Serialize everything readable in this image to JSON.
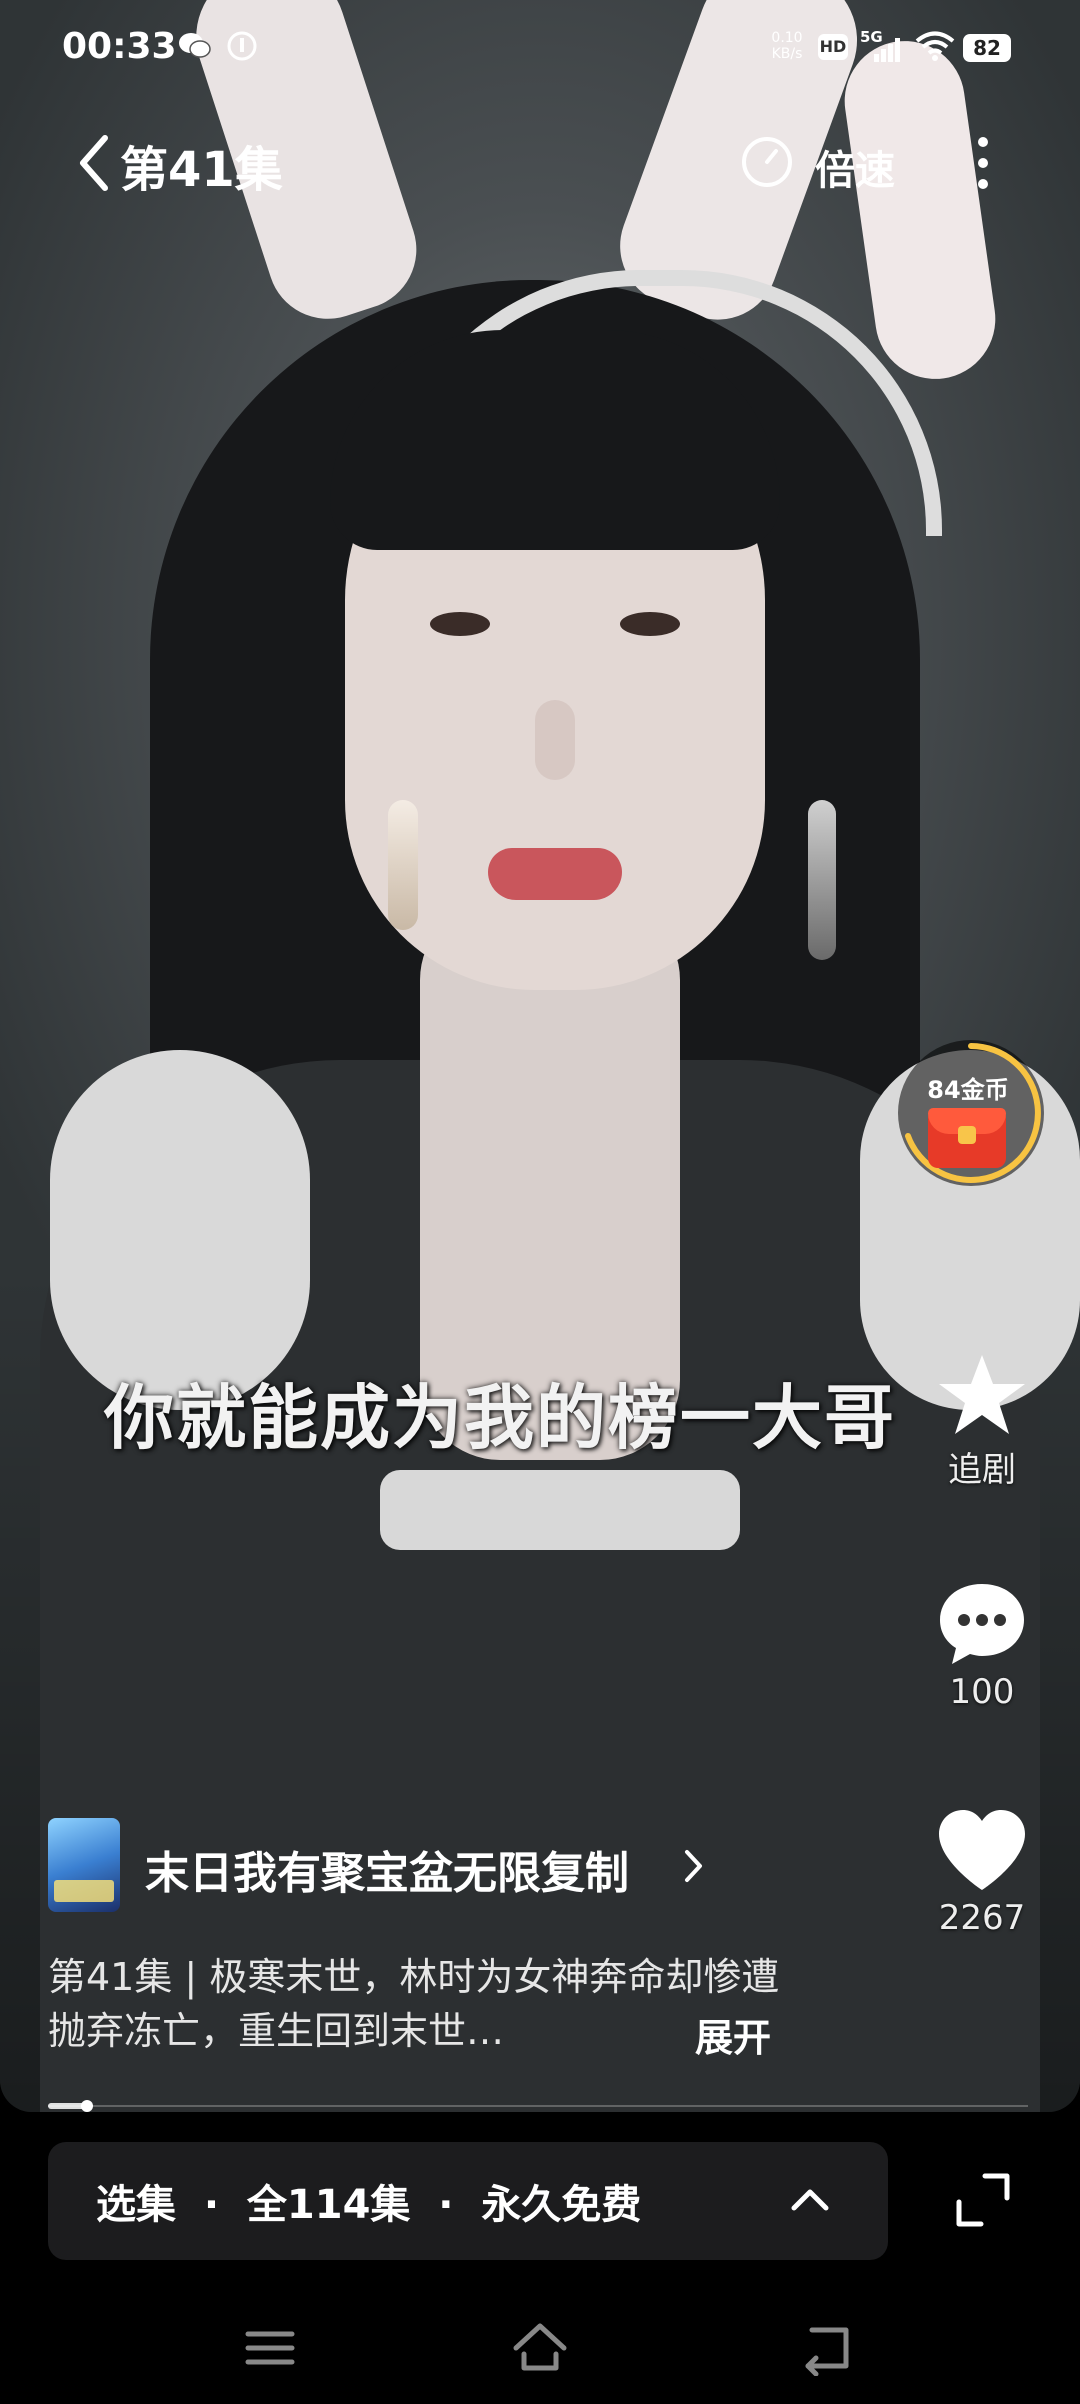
{
  "status_bar": {
    "time": "00:33",
    "net_speed_value": "0.10",
    "net_speed_unit": "KB/s",
    "hd_label": "HD",
    "network_label": "5G",
    "battery": "82",
    "icons": [
      "wechat-icon",
      "app-notification-icon",
      "hd-icon",
      "signal-icon",
      "wifi-icon",
      "battery-icon"
    ]
  },
  "top_bar": {
    "title": "第41集",
    "speed_label": "倍速"
  },
  "video": {
    "subtitle": "你就能成为我的榜一大哥"
  },
  "right_rail": {
    "reward_label": "84金币",
    "follow_label": "追剧",
    "comment_count": "100",
    "like_count": "2267"
  },
  "drama": {
    "name": "末日我有聚宝盆无限复制",
    "description": "第41集 | 极寒末世，林时为女神奔命却惨遭抛弃冻亡，重生回到末世…",
    "expand_label": "展开",
    "progress": 0.04
  },
  "bottom_bar": {
    "select_label": "选集",
    "separator": "·",
    "total_label": "全114集",
    "free_label": "永久免费"
  },
  "colors": {
    "accent_gold": "#f7c342",
    "red_packet": "#e73a28",
    "bar_bg": "#1c1c1e"
  }
}
